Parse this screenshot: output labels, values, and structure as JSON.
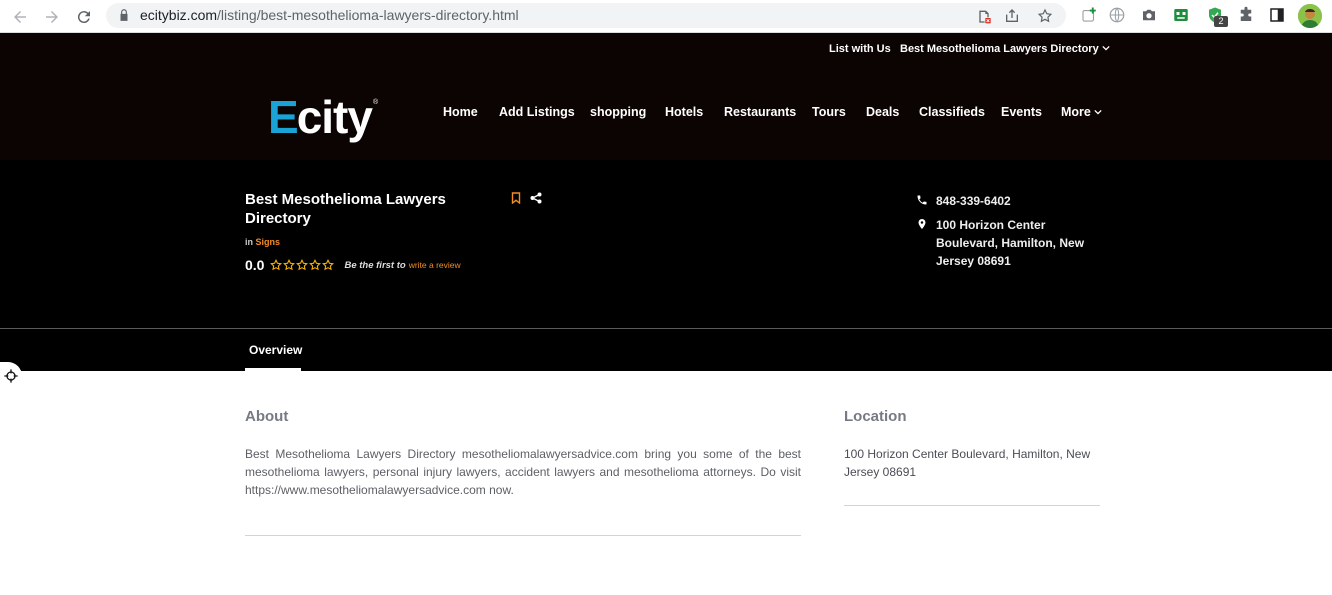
{
  "browser": {
    "url_host": "ecitybiz.com",
    "url_path": "/listing/best-mesothelioma-lawyers-directory.html",
    "extension_badge": "2"
  },
  "site": {
    "topbar": {
      "list_with_us": "List with Us",
      "directory_dropdown": "Best Mesothelioma Lawyers Directory"
    },
    "logo": {
      "first_letter": "E",
      "rest": "city",
      "mark": "®"
    },
    "menu": [
      "Home",
      "Add Listings",
      "shopping",
      "Hotels",
      "Restaurants",
      "Tours",
      "Deals",
      "Classifieds",
      "Events",
      "More"
    ]
  },
  "listing": {
    "title": "Best Mesothelioma Lawyers Directory",
    "in_label": "in",
    "category": "Signs",
    "rating": "0.0",
    "stars_filled": 0,
    "stars_total": 5,
    "first_review_text": "Be the first to",
    "write_review_link": "write a review",
    "phone": "848-339-6402",
    "address": "100 Horizon Center Boulevard, Hamilton, New Jersey 08691"
  },
  "tabs": [
    "Overview"
  ],
  "about": {
    "heading": "About",
    "text": "Best Mesothelioma Lawyers Directory mesotheliomalawyersadvice.com bring you some of the best mesothelioma lawyers, personal injury lawyers, accident lawyers and mesothelioma attorneys. Do visit https://www.mesotheliomalawyersadvice.com now."
  },
  "location": {
    "heading": "Location",
    "text": "100 Horizon Center Boulevard, Hamilton, New Jersey 08691"
  },
  "colors": {
    "accent_orange": "#f28c28",
    "logo_blue": "#1aa3d6",
    "header_bg": "#0c0303",
    "hero_bg": "#000000"
  },
  "icons": [
    "back-arrow-icon",
    "forward-arrow-icon",
    "reload-icon",
    "lock-icon",
    "blocked-popup-icon",
    "share-icon",
    "bookmark-star-icon",
    "phone-icon",
    "map-pin-icon",
    "bookmark-icon",
    "share-nodes-icon",
    "star-outline-icon",
    "move-tool-icon"
  ]
}
